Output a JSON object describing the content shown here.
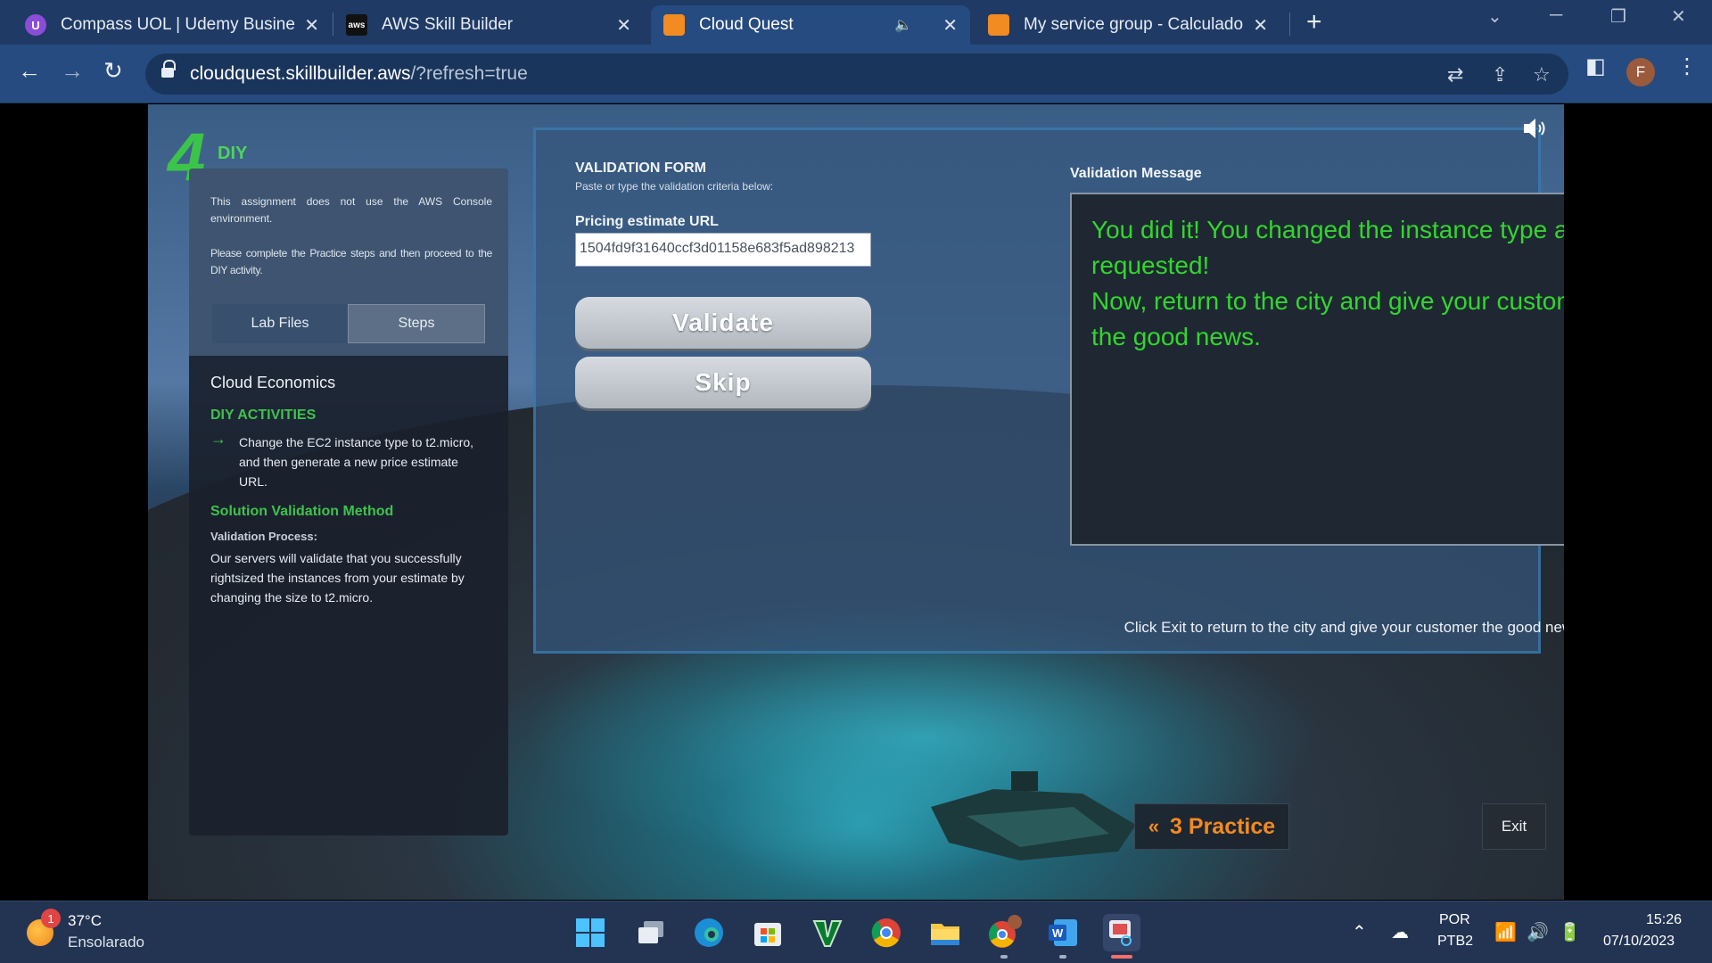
{
  "browser": {
    "tabs": [
      {
        "title": "Compass UOL | Udemy Business",
        "favicon": "udemy-icon"
      },
      {
        "title": "AWS Skill Builder",
        "favicon": "aws-icon"
      },
      {
        "title": "Cloud Quest",
        "favicon": "cloudquest-icon",
        "active": true,
        "audio": true
      },
      {
        "title": "My service group - Calculadora de Preço",
        "favicon": "calculator-icon"
      }
    ],
    "url_host": "cloudquest.skillbuilder.aws",
    "url_rest": "/?refresh=true",
    "profile_initial": "F"
  },
  "game": {
    "level_number": "4",
    "level_label": "DIY",
    "left_panel": {
      "note1": "This assignment does not use the AWS Console environment.",
      "note2": "Please complete the Practice steps and then proceed to the DIY activity.",
      "tabs": [
        "Lab Files",
        "Steps"
      ],
      "selected_tab": "Steps",
      "heading": "Cloud Economics",
      "diy_title": "DIY ACTIVITIES",
      "diy_item": "Change the EC2 instance type to t2.micro, and then generate a new price estimate URL.",
      "solution_title": "Solution Validation Method",
      "validation_process_label": "Validation Process:",
      "validation_process_text": "Our servers will validate that you successfully rightsized the instances from your estimate by changing the size to t2.micro."
    },
    "form": {
      "title": "VALIDATION FORM",
      "subtitle": "Paste or type the validation criteria below:",
      "url_label": "Pricing estimate URL",
      "url_value": "1504fd9f31640ccf3d01158e683f5ad898213",
      "validate_label": "Validate",
      "skip_label": "Skip"
    },
    "message": {
      "title": "Validation Message",
      "text": "You did it! You changed the instance type as requested!\nNow, return to the city and give your customer the good news.",
      "footer": "Click Exit to return to the city and give your customer the good news!",
      "color": "#32d62e"
    },
    "practice_label": "3 Practice",
    "exit_label": "Exit"
  },
  "taskbar": {
    "weather_temp": "37°C",
    "weather_desc": "Ensolarado",
    "weather_badge": "1",
    "lang_top": "POR",
    "lang_bottom": "PTB2",
    "time": "15:26",
    "date": "07/10/2023"
  }
}
